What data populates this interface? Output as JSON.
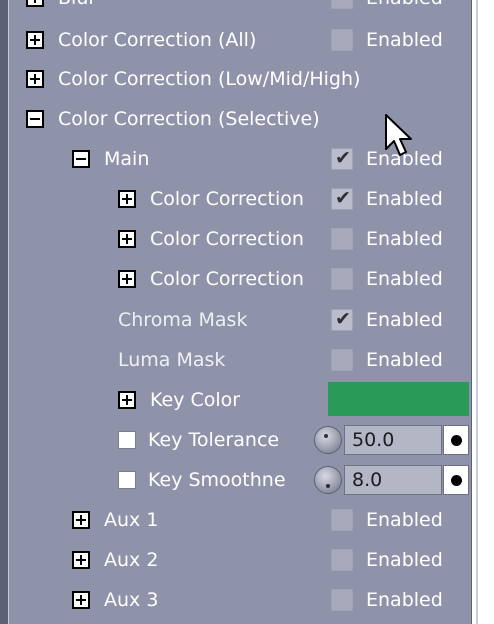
{
  "enabled_label": "Enabled",
  "rows": {
    "top_partial": "Blur",
    "cc_all": "Color Correction (All)",
    "cc_lmh": "Color Correction (Low/Mid/High)",
    "cc_selective": "Color Correction (Selective)",
    "main": "Main",
    "cc1": "Color Correction",
    "cc2": "Color Correction",
    "cc3": "Color Correction",
    "chroma_mask": "Chroma Mask",
    "luma_mask": "Luma Mask",
    "key_color": "Key Color",
    "key_tolerance": "Key Tolerance",
    "key_smoothness": "Key Smoothne",
    "aux1": "Aux 1",
    "aux2": "Aux 2",
    "aux3": "Aux 3"
  },
  "values": {
    "key_tolerance": "50.0",
    "key_smoothness": "8.0"
  },
  "colors": {
    "key_color_swatch": "#2a9a58",
    "panel_bg": "#8f93a9"
  },
  "icons": {
    "expand": "plus-box-icon",
    "collapse": "minus-box-icon",
    "check": "check-icon",
    "cursor": "mouse-pointer-icon"
  },
  "checked": {
    "main": true,
    "cc1": true,
    "cc2": false,
    "cc3": false,
    "chroma_mask": true,
    "luma_mask": false,
    "cc_all": false,
    "aux1": false,
    "aux2": false,
    "aux3": false
  }
}
